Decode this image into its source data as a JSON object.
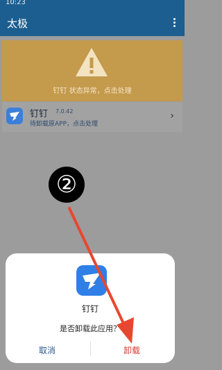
{
  "status_bar": {
    "time": "10:23"
  },
  "app_bar": {
    "title": "太极",
    "menu_icon": "more-vert-icon"
  },
  "warning": {
    "icon": "warning-triangle-icon",
    "message": "钉钉 状态异常，点击处理",
    "color": "#c49a4c"
  },
  "app_item": {
    "name": "钉钉",
    "version": "7.0.42",
    "subtitle": "待卸载原APP，点击处理",
    "icon": "dingtalk-app-icon",
    "chevron": "›"
  },
  "annotation": {
    "step": "②",
    "arrow_color": "#e8472f"
  },
  "dialog": {
    "app_name": "钉钉",
    "question": "是否卸载此应用？",
    "cancel_label": "取消",
    "uninstall_label": "卸载",
    "icon": "dingtalk-app-icon"
  }
}
